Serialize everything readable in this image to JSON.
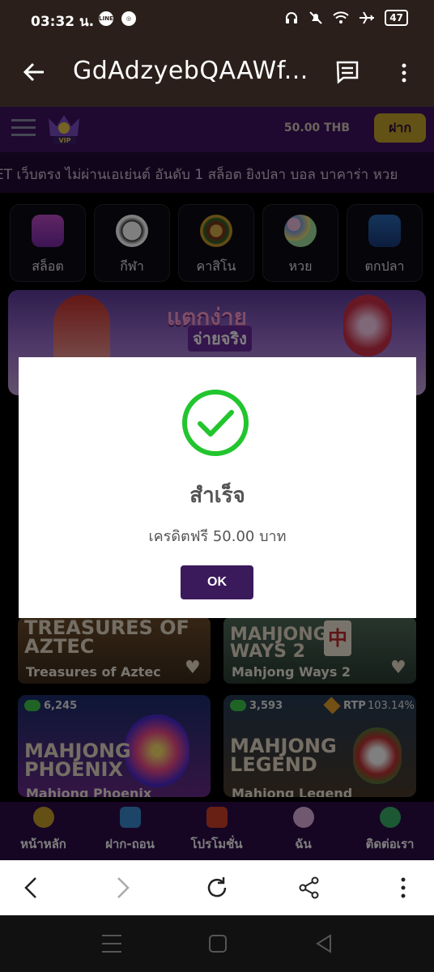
{
  "status_bar": {
    "time": "03:32 น.",
    "battery": "47"
  },
  "browser": {
    "title": "GdAdzyebQAAWf..."
  },
  "site": {
    "balance": "50.00 THB",
    "deposit_label": "ฝาก",
    "marquee": "ET เว็บตรง ไม่ผ่านเอเย่นต์ อันดับ 1 สล็อต ยิงปลา บอล บาคาร่า หวย"
  },
  "categories": [
    {
      "label": "สล็อต",
      "icon": "slot-machine-icon"
    },
    {
      "label": "กีฬา",
      "icon": "soccer-ball-icon"
    },
    {
      "label": "คาสิโน",
      "icon": "roulette-icon"
    },
    {
      "label": "หวย",
      "icon": "lottery-balls-icon"
    },
    {
      "label": "ตกปลา",
      "icon": "fish-icon"
    }
  ],
  "banner": {
    "headline": "แตกง่าย",
    "subline": "จ่ายจริง"
  },
  "games": [
    {
      "art_title": "TREASURES OF AZTEC",
      "name": "Treasures of Aztec"
    },
    {
      "art_title": "MAHJONG WAYS 2",
      "name": "Mahjong Ways 2"
    },
    {
      "art_title": "MAHJONG PHOENIX",
      "name": "Mahjong Phoenix",
      "players": "6,245"
    },
    {
      "art_title": "MAHJONG LEGEND",
      "name": "Mahjong Legend",
      "players": "3,593",
      "rtp_label": "RTP",
      "rtp": "103.14%"
    }
  ],
  "bottom_nav": [
    {
      "label": "หน้าหลัก",
      "icon": "home-icon"
    },
    {
      "label": "ฝาก-ถอน",
      "icon": "wallet-icon"
    },
    {
      "label": "โปรโมชั่น",
      "icon": "gift-icon"
    },
    {
      "label": "ฉัน",
      "icon": "profile-icon"
    },
    {
      "label": "ติดต่อเรา",
      "icon": "support-icon"
    }
  ],
  "modal": {
    "title": "สำเร็จ",
    "message": "เครดิตฟรี 50.00 บาท",
    "ok_label": "OK",
    "accent": "#22c52e",
    "button_color": "#3b1a5c"
  }
}
